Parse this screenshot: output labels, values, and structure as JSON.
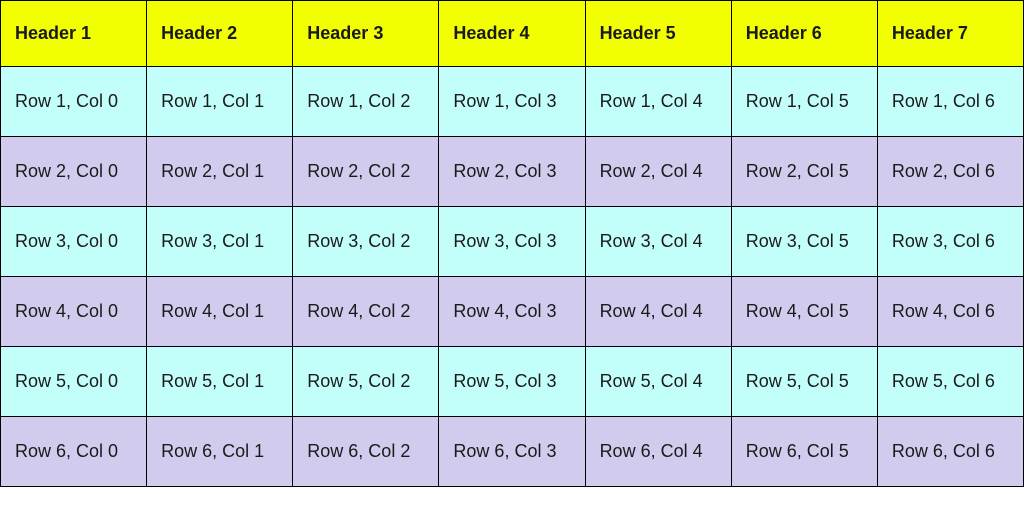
{
  "table": {
    "headers": [
      "Header 1",
      "Header 2",
      "Header 3",
      "Header 4",
      "Header 5",
      "Header 6",
      "Header 7"
    ],
    "rows": [
      [
        "Row 1, Col 0",
        "Row 1, Col 1",
        "Row 1, Col 2",
        "Row 1, Col 3",
        "Row 1, Col 4",
        "Row 1, Col 5",
        "Row 1, Col 6"
      ],
      [
        "Row 2, Col 0",
        "Row 2, Col 1",
        "Row 2, Col 2",
        "Row 2, Col 3",
        "Row 2, Col 4",
        "Row 2, Col 5",
        "Row 2, Col 6"
      ],
      [
        "Row 3, Col 0",
        "Row 3, Col 1",
        "Row 3, Col 2",
        "Row 3, Col 3",
        "Row 3, Col 4",
        "Row 3, Col 5",
        "Row 3, Col 6"
      ],
      [
        "Row 4, Col 0",
        "Row 4, Col 1",
        "Row 4, Col 2",
        "Row 4, Col 3",
        "Row 4, Col 4",
        "Row 4, Col 5",
        "Row 4, Col 6"
      ],
      [
        "Row 5, Col 0",
        "Row 5, Col 1",
        "Row 5, Col 2",
        "Row 5, Col 3",
        "Row 5, Col 4",
        "Row 5, Col 5",
        "Row 5, Col 6"
      ],
      [
        "Row 6, Col 0",
        "Row 6, Col 1",
        "Row 6, Col 2",
        "Row 6, Col 3",
        "Row 6, Col 4",
        "Row 6, Col 5",
        "Row 6, Col 6"
      ]
    ]
  }
}
